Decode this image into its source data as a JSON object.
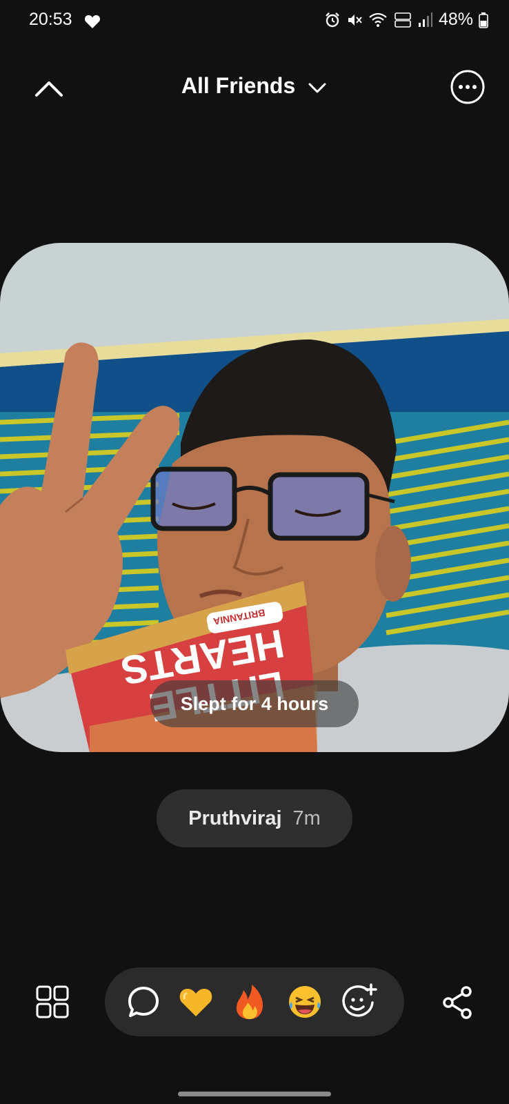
{
  "status_bar": {
    "time": "20:53",
    "battery_percent": "48%",
    "icons": [
      "heart-icon",
      "alarm-icon",
      "mute-icon",
      "wifi-icon",
      "volte-icon",
      "signal-icon",
      "battery-icon"
    ]
  },
  "header": {
    "title": "All Friends"
  },
  "post": {
    "caption": "Slept for 4 hours",
    "photo_subject": "selfie with peace sign and snack packet"
  },
  "author": {
    "name": "Pruthviraj",
    "time_ago": "7m"
  },
  "reactions": [
    "comment-icon",
    "yellow-heart-emoji",
    "fire-emoji",
    "laughing-emoji",
    "add-reaction-icon"
  ],
  "colors": {
    "background": "#111111",
    "pill": "#2f2f2f",
    "reaction_bar": "#2b2b2b"
  }
}
